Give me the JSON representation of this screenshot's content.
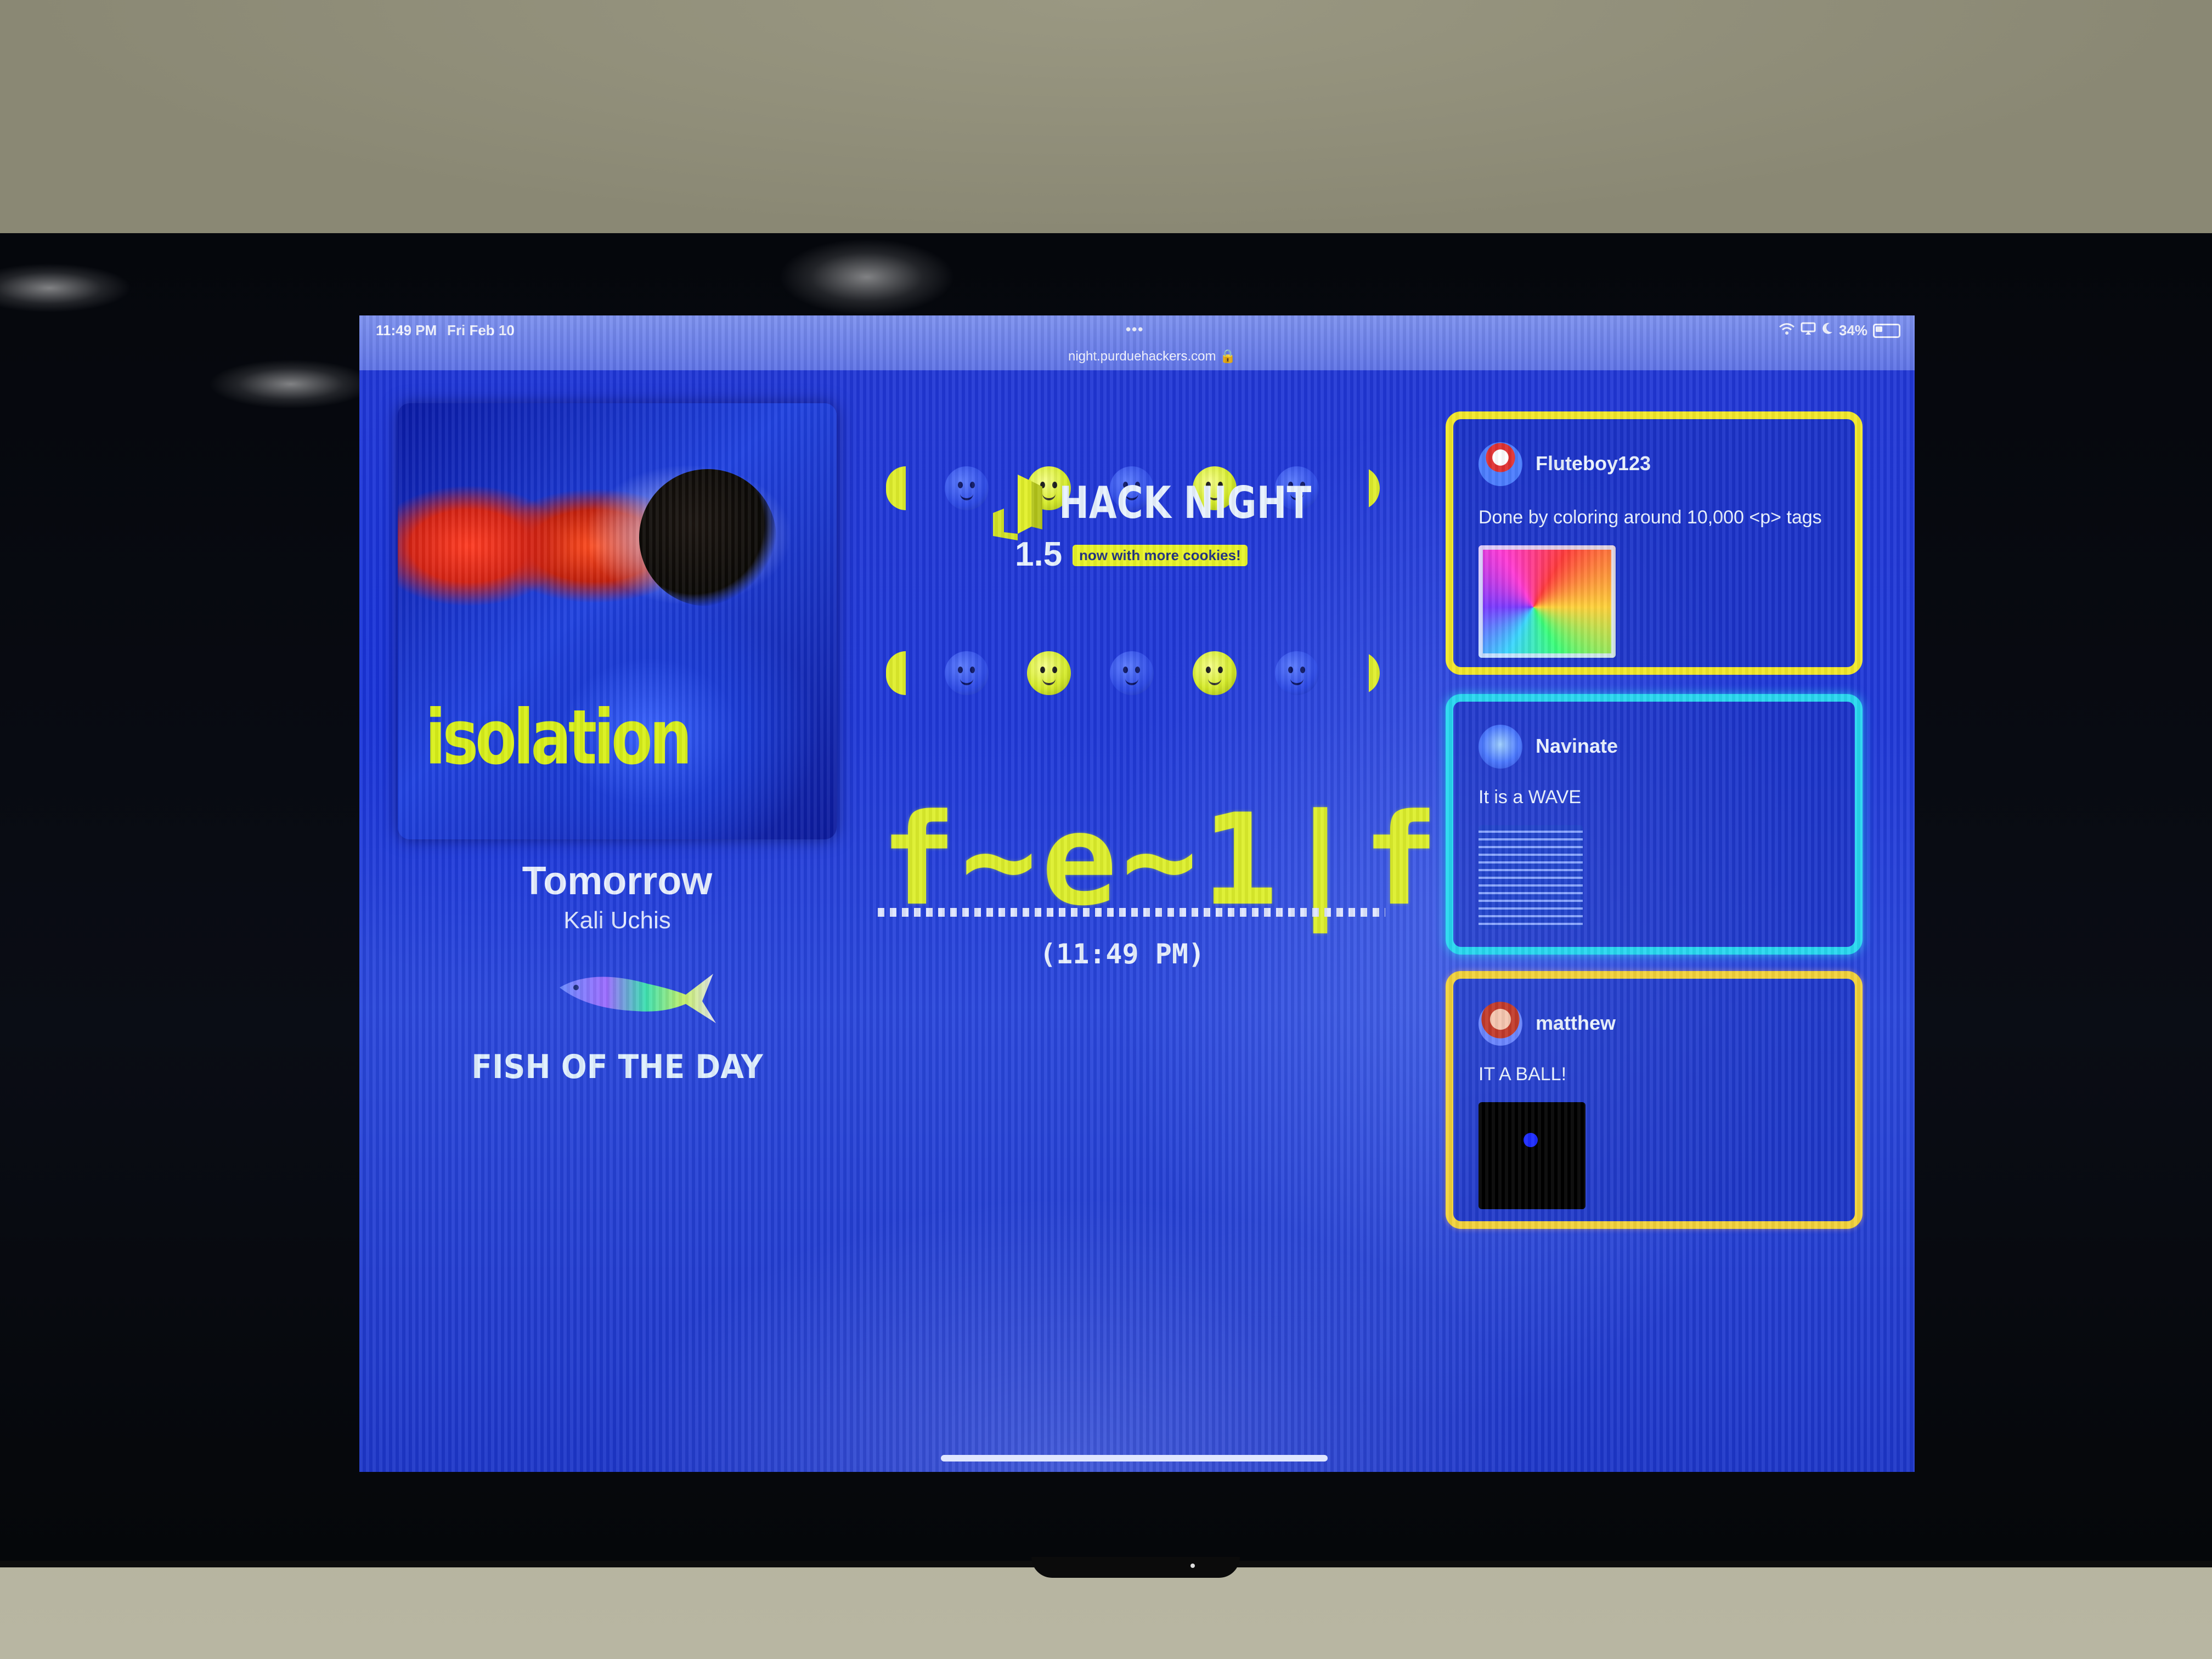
{
  "status_bar": {
    "time": "11:49 PM",
    "date": "Fri Feb 10",
    "dots": "•••",
    "url": "night.purduehackers.com 🔒",
    "battery": "34%"
  },
  "now_playing": {
    "album_art_title": "isolation",
    "song_title": "Tomorrow",
    "artist": "Kali Uchis"
  },
  "fish": {
    "label": "FISH OF THE DAY"
  },
  "hack_night": {
    "title": "HACK NIGHT",
    "version": "1.5",
    "badge": "now with more cookies!"
  },
  "clock": {
    "glyphs": "f~e~1|f",
    "time": "(11:49 PM)"
  },
  "posts": [
    {
      "username": "Fluteboy123",
      "text": "Done by coloring around 10,000 <p> tags",
      "accent": "#f2e82a"
    },
    {
      "username": "Navinate",
      "text": "It is a WAVE",
      "accent": "#27d8f0"
    },
    {
      "username": "matthew",
      "text": "IT A BALL!",
      "accent": "#f2d23a"
    }
  ],
  "colors": {
    "screen_bg": "#1f38d8",
    "accent_yellow": "#ddef2c",
    "text_light": "#e8f0ff"
  }
}
